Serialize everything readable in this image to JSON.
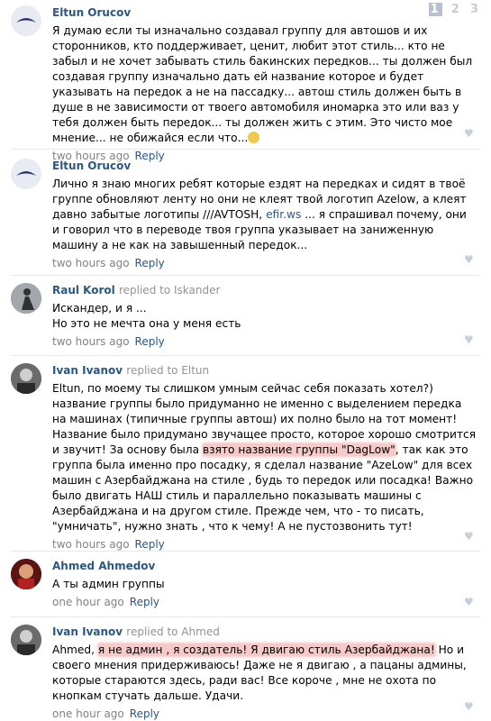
{
  "pagination": {
    "pages": [
      "1",
      "2",
      "3"
    ]
  },
  "comments": [
    {
      "author": "Eltun Orucov",
      "text": "Я думаю если ты изначально создавал группу для автошов и их сторонников, кто поддерживает, ценит, любит этот стиль... кто не забыл и не хочет забывать стиль бакинских передков... ты должен был создавая группу изначально дать ей название которое и будет указывать на передок а не на пассадку... автош стиль должен быть в душе в не зависимости от твоего автомобиля иномарка это или ваз у тебя должен быть передок... ты должен жить с этим. Это чисто мое мнение... не обижайся если что...",
      "time": "two hours ago",
      "reply": "Reply"
    },
    {
      "author": "Eltun Orucov",
      "text_a": "Лично я знаю многих ребят которые ездят на передках и сидят в твоё группе обновляют ленту но они не клеят твой логотип Azelow, а клеят давно забытые логотипы ///AVTOSH, ",
      "link": "efir.ws",
      "text_b": " ... я спрашивал почему, они и говорил что в переводе твоя группа указывает на заниженную машину а не как на завышенный передок...",
      "time": "two hours ago",
      "reply": "Reply"
    },
    {
      "author": "Raul Korol",
      "replied": "replied to Iskander",
      "text_a": "Искандер, и я ...",
      "text_b": "Но это не мечта она у меня есть",
      "time": "two hours ago",
      "reply": "Reply"
    },
    {
      "author": "Ivan Ivanov",
      "replied": "replied to Eltun",
      "text_a": "Eltun, по моему ты слишком умным сейчас себя показать хотел?) название группы было придуманно не именно с выделением передка на машинах (типичные группы автош) их полно было на тот момент! Название было придумано звучащее просто, которое хорошо смотрится и звучит! За основу была ",
      "highlight": "взято название группы \"DagLow\"",
      "text_b": ", так как это группа была именно про посадку, я сделал название \"AzeLow\" для всех машин с Азербайджана на стиле , будь то передок или посадка! Важно было двигать НАШ стиль и параллельно показывать машины с Азербайджана и на другом стиле. Прежде чем, что - то писать, \"умничать\", нужно знать , что к чему! А не пустозвонить тут!",
      "time": "two hours ago",
      "reply": "Reply"
    },
    {
      "author": "Ahmed Ahmedov",
      "text": "А ты админ группы",
      "time": "one hour ago",
      "reply": "Reply"
    },
    {
      "author": "Ivan Ivanov",
      "replied": "replied to Ahmed",
      "text_a": "Ahmed, ",
      "highlight": "я не админ , я создатель! Я двигаю стиль Азербайджана!",
      "text_b": " Но и своего мнения придерживаюсь! Даже не я двигаю , а пацаны админы, которые стараются здесь, ради вас! Все короче , мне не охота по кнопкам стучать дальше. Удачи.",
      "time": "one hour ago",
      "reply": "Reply"
    }
  ],
  "colors": {
    "name": "#2a5885",
    "meta": "#828282",
    "highlight": "#f7c9c9"
  }
}
